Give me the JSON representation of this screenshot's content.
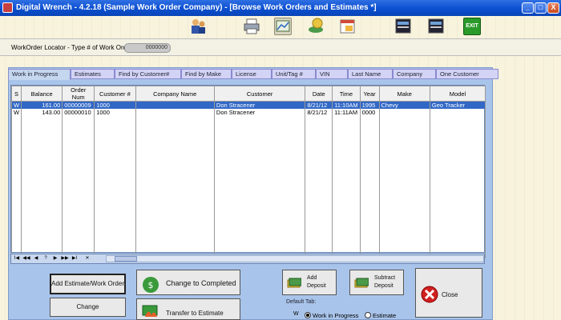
{
  "window": {
    "title": "Digital Wrench - 4.2.18 (Sample Work Order Company) - [Browse Work Orders and Estimates *]"
  },
  "titlebar_buttons": [
    "_",
    "□",
    "X"
  ],
  "toolbar": {
    "exit_label": "EXIT"
  },
  "locator": {
    "label": "WorkOrder Locator - Type # of Work Order",
    "value": "0000000"
  },
  "tabs": [
    "Work in Progress",
    "Estimates",
    "Find by Customer#",
    "Find by Make",
    "License",
    "Unit/Tag #",
    "VIN",
    "Last Name",
    "Company",
    "One Customer"
  ],
  "grid": {
    "columns": [
      "S",
      "Balance",
      "Order Num",
      "Customer #",
      "Company Name",
      "Customer",
      "Date",
      "Time",
      "Year",
      "Make",
      "Model"
    ],
    "rows": [
      [
        "W",
        "161.00",
        "00000009",
        "1000",
        "",
        "Don Stracener",
        "8/21/12",
        "11:10AM",
        "1995",
        "Chevy",
        "Geo Tracker"
      ],
      [
        "W",
        "143.00",
        "00000010",
        "1000",
        "",
        "Don Stracener",
        "8/21/12",
        "11:11AM",
        "0000",
        "",
        ""
      ]
    ]
  },
  "nav": [
    "I◀",
    "◀◀",
    "◀",
    "?",
    "▶",
    "▶▶",
    "▶I",
    "✕"
  ],
  "buttons": {
    "add": "Add Estimate/Work Order",
    "change": "Change",
    "completed": "Change to Completed",
    "transfer": "Transfer to Estimate",
    "add_deposit_1": "Add",
    "add_deposit_2": "Deposit",
    "sub_deposit_1": "Subtract",
    "sub_deposit_2": "Deposit",
    "close": "Close"
  },
  "default_tab": {
    "label": "Default Tab:",
    "prefix": "W",
    "opt1": "Work in Progress",
    "opt2": "Estimate"
  },
  "colors": {
    "title_bar": "#0b4fd0",
    "selection": "#3168c6",
    "panel": "#a9c4ea",
    "tab": "#d3d3f5"
  }
}
